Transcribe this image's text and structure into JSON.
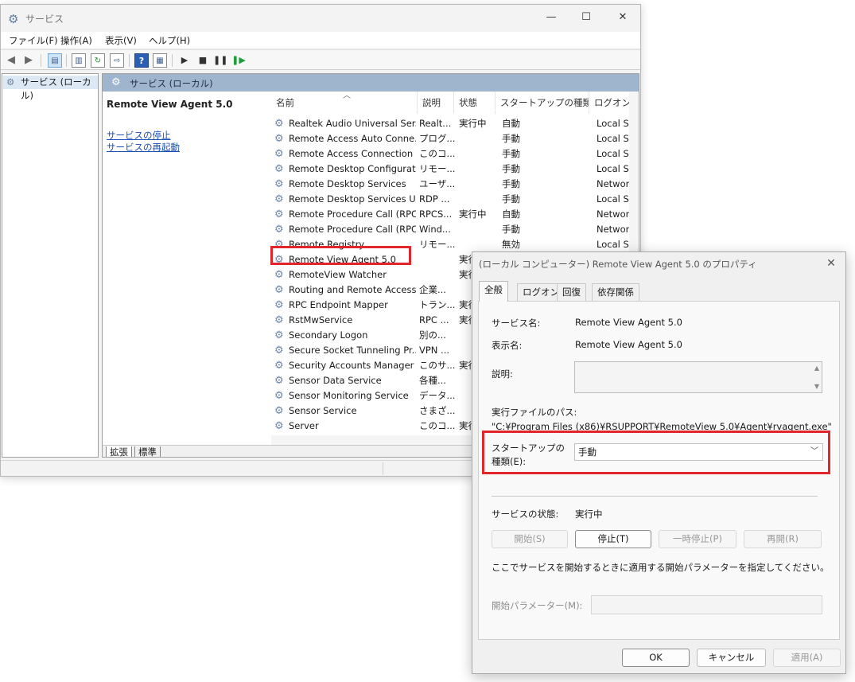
{
  "services_window": {
    "title": "サービス",
    "menu": [
      "ファイル(F)",
      "操作(A)",
      "表示(V)",
      "ヘルプ(H)"
    ],
    "tree_root": "サービス (ローカル)",
    "pane_header": "サービス (ローカル)",
    "selected_service_title": "Remote View Agent 5.0",
    "actions": [
      "サービスの停止",
      "サービスの再起動"
    ],
    "columns": [
      "名前",
      "説明",
      "状態",
      "スタートアップの種類",
      "ログオン"
    ],
    "rows": [
      {
        "name": "Realtek Audio Universal Ser...",
        "desc": "Realt...",
        "status": "実行中",
        "startup": "自動",
        "logon": "Local S"
      },
      {
        "name": "Remote Access Auto Conne...",
        "desc": "プログ...",
        "status": "",
        "startup": "手動",
        "logon": "Local S"
      },
      {
        "name": "Remote Access Connection ...",
        "desc": "このコ...",
        "status": "",
        "startup": "手動",
        "logon": "Local S"
      },
      {
        "name": "Remote Desktop Configurati...",
        "desc": "リモー...",
        "status": "",
        "startup": "手動",
        "logon": "Local S"
      },
      {
        "name": "Remote Desktop Services",
        "desc": "ユーザ...",
        "status": "",
        "startup": "手動",
        "logon": "Networ"
      },
      {
        "name": "Remote Desktop Services Us...",
        "desc": "RDP ...",
        "status": "",
        "startup": "手動",
        "logon": "Local S"
      },
      {
        "name": "Remote Procedure Call (RPC)",
        "desc": "RPCS...",
        "status": "実行中",
        "startup": "自動",
        "logon": "Networ"
      },
      {
        "name": "Remote Procedure Call (RPC...",
        "desc": "Wind...",
        "status": "",
        "startup": "手動",
        "logon": "Networ"
      },
      {
        "name": "Remote Registry",
        "desc": "リモー...",
        "status": "",
        "startup": "無効",
        "logon": "Local S"
      },
      {
        "name": "Remote View Agent 5.0",
        "desc": "",
        "status": "実行",
        "startup": "",
        "logon": ""
      },
      {
        "name": "RemoteView Watcher",
        "desc": "",
        "status": "実行",
        "startup": "",
        "logon": ""
      },
      {
        "name": "Routing and Remote Access",
        "desc": "企業...",
        "status": "",
        "startup": "",
        "logon": ""
      },
      {
        "name": "RPC Endpoint Mapper",
        "desc": "トラン...",
        "status": "実行",
        "startup": "",
        "logon": ""
      },
      {
        "name": "RstMwService",
        "desc": "RPC ...",
        "status": "実行",
        "startup": "",
        "logon": ""
      },
      {
        "name": "Secondary Logon",
        "desc": "別の...",
        "status": "",
        "startup": "",
        "logon": ""
      },
      {
        "name": "Secure Socket Tunneling Pr...",
        "desc": "VPN ...",
        "status": "",
        "startup": "",
        "logon": ""
      },
      {
        "name": "Security Accounts Manager",
        "desc": "このサ...",
        "status": "実行",
        "startup": "",
        "logon": ""
      },
      {
        "name": "Sensor Data Service",
        "desc": "各種...",
        "status": "",
        "startup": "",
        "logon": ""
      },
      {
        "name": "Sensor Monitoring Service",
        "desc": "データ...",
        "status": "",
        "startup": "",
        "logon": ""
      },
      {
        "name": "Sensor Service",
        "desc": "さまざ...",
        "status": "",
        "startup": "",
        "logon": ""
      },
      {
        "name": "Server",
        "desc": "このコ...",
        "status": "実行",
        "startup": "",
        "logon": ""
      }
    ],
    "bottom_tabs": [
      "拡張",
      "標準"
    ]
  },
  "dialog": {
    "title": "(ローカル コンピューター) Remote View Agent 5.0 のプロパティ",
    "tabs": [
      "全般",
      "ログオン",
      "回復",
      "依存関係"
    ],
    "service_name_label": "サービス名:",
    "service_name": "Remote View Agent 5.0",
    "display_name_label": "表示名:",
    "display_name": "Remote View Agent 5.0",
    "description_label": "説明:",
    "exe_path_label": "実行ファイルのパス:",
    "exe_path": "\"C:¥Program Files (x86)¥RSUPPORT¥RemoteView 5.0¥Agent¥rvagent.exe\"",
    "startup_type_label_1": "スタートアップの",
    "startup_type_label_2": "種類(E):",
    "startup_type": "手動",
    "service_status_label": "サービスの状態:",
    "service_status": "実行中",
    "buttons": [
      "開始(S)",
      "停止(T)",
      "一時停止(P)",
      "再開(R)"
    ],
    "hint": "ここでサービスを開始するときに適用する開始パラメーターを指定してください。",
    "start_params_label": "開始パラメーター(M):",
    "ok": "OK",
    "cancel": "キャンセル",
    "apply": "適用(A)"
  },
  "colors": {
    "highlight": "#e0252b",
    "pane_header": "#9fb4cd"
  }
}
